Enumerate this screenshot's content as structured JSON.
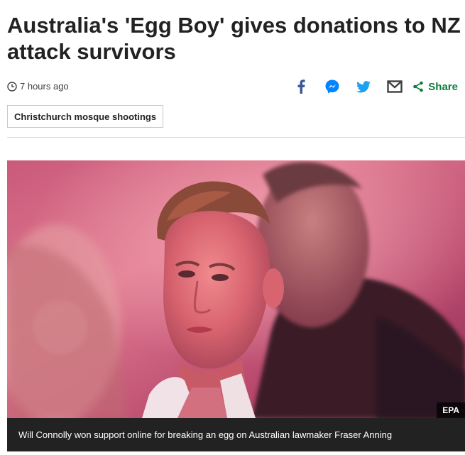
{
  "article": {
    "headline": "Australia's 'Egg Boy' gives donations to NZ attack survivors",
    "timestamp": "7 hours ago",
    "tag": "Christchurch mosque shootings"
  },
  "share": {
    "items": [
      {
        "icon": "facebook-icon",
        "color": "#3b5998"
      },
      {
        "icon": "messenger-icon",
        "color": "#0084ff"
      },
      {
        "icon": "twitter-icon",
        "color": "#1da1f2"
      },
      {
        "icon": "email-icon",
        "color": "#404040"
      }
    ],
    "share_label": "Share",
    "share_color": "#0f7d3c"
  },
  "image": {
    "credit": "EPA",
    "caption": "Will Connolly won support online for breaking an egg on Australian lawmaker Fraser Anning"
  }
}
